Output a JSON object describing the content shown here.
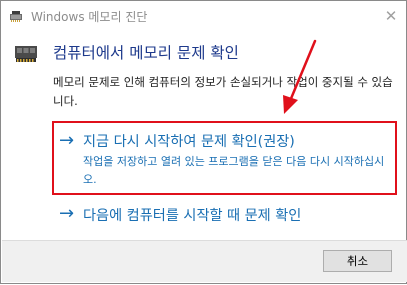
{
  "window": {
    "title": "Windows 메모리 진단",
    "close_glyph": "✕"
  },
  "header": {
    "title": "컴퓨터에서 메모리 문제 확인"
  },
  "description": "메모리 문제로 인해 컴퓨터의 정보가 손실되거나 작업이 중지될 수 있습니다.",
  "options": [
    {
      "arrow": "→",
      "title": "지금 다시 시작하여 문제 확인(권장)",
      "description": "작업을 저장하고 열려 있는 프로그램을 닫은 다음 다시 시작하십시오."
    },
    {
      "arrow": "→",
      "title": "다음에 컴퓨터를 시작할 때 문제 확인"
    }
  ],
  "footer": {
    "cancel_label": "취소"
  },
  "colors": {
    "link_blue": "#1a6fb3",
    "header_blue": "#1e3a8c",
    "highlight_red": "#e0101b"
  }
}
